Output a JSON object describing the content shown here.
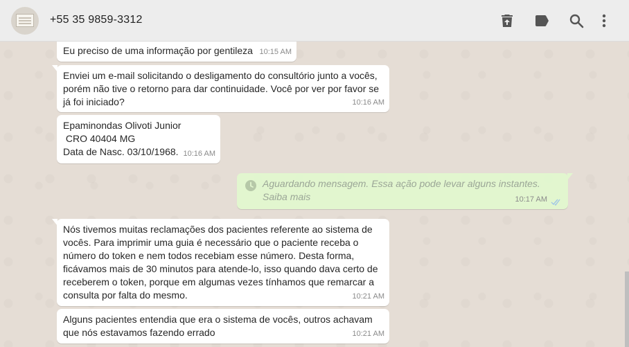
{
  "header": {
    "contact": "+55 35 9859-3312",
    "icons": [
      "delete-icon",
      "label-icon",
      "search-icon",
      "menu-icon"
    ]
  },
  "messages": [
    {
      "text": "Eu preciso de uma informação por gentileza",
      "time": "10:15 AM"
    },
    {
      "text": "Enviei um e-mail solicitando o desligamento do consultório junto a vocês, porém não tive o retorno para dar continuidade. Você por ver por favor se já foi iniciado?",
      "time": "10:16 AM"
    },
    {
      "text": "Epaminondas Olivoti Junior\n CRO 40404 MG\nData de Nasc. 03/10/1968.",
      "time": "10:16 AM"
    },
    {
      "text": "Aguardando mensagem. Essa ação pode levar alguns instantes. Saiba mais",
      "time": "10:17 AM"
    },
    {
      "text": "Nós tivemos muitas reclamações dos pacientes referente ao sistema de vocês. Para imprimir uma guia é necessário que o paciente receba o número do token e nem todos recebiam esse número. Desta forma, ficávamos mais de 30 minutos para atende-lo, isso quando dava certo de receberem o token, porque em algumas vezes tínhamos que remarcar a consulta por falta do mesmo.",
      "time": "10:21 AM"
    },
    {
      "text": "Alguns pacientes entendia que era o sistema de vocês, outros achavam que nós estavamos fazendo errado",
      "time": "10:21 AM"
    }
  ],
  "colors": {
    "incoming_bubble": "#ffffff",
    "outgoing_bubble": "#e2f7cf",
    "chat_background": "#e5ddd5",
    "header_background": "#ededed",
    "icon": "#555555",
    "read_ticks": "#9ec5e8"
  }
}
